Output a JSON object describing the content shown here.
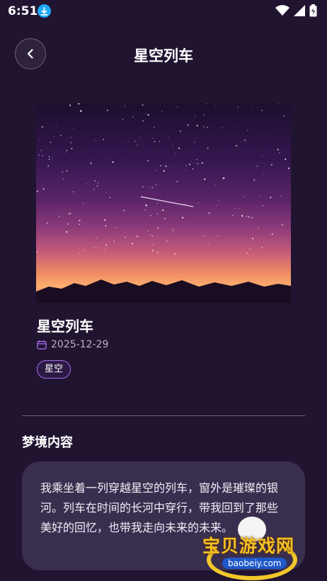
{
  "status_bar": {
    "time": "6:51"
  },
  "header": {
    "title": "星空列车",
    "back_icon": "chevron-left-icon"
  },
  "dream": {
    "title": "星空列车",
    "date": "2025-12-29",
    "date_icon": "calendar-icon",
    "tag": "星空"
  },
  "section": {
    "title": "梦境内容",
    "content": "我乘坐着一列穿越星空的列车，窗外是璀璨的银河。列车在时间的长河中穿行，带我回到了那些美好的回忆，也带我走向未来的未来。"
  },
  "watermark": {
    "text": "宝贝游戏网",
    "url": "baobeiy.com"
  },
  "colors": {
    "background": "#211431",
    "card": "#3a2e4f",
    "tag_border": "#a36dea",
    "accent_download": "#1ea7f5"
  }
}
